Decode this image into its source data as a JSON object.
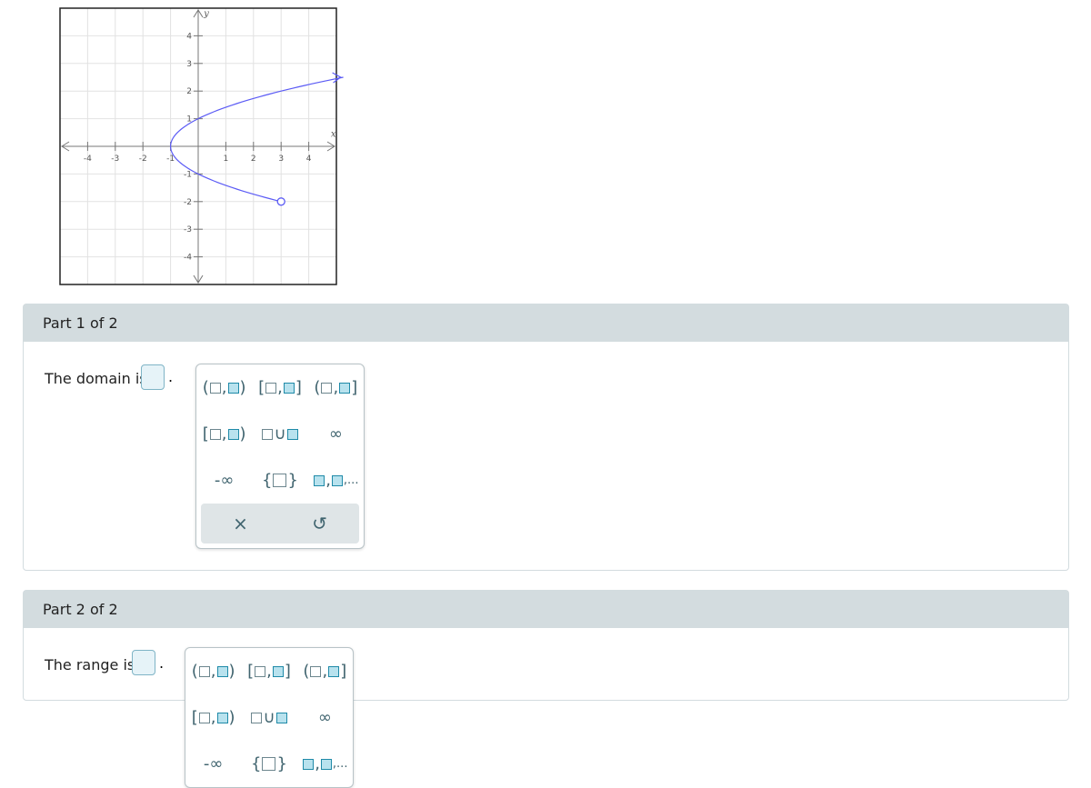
{
  "graph": {
    "x_label": "x",
    "y_label": "y",
    "x_ticks": [
      -4,
      -3,
      -2,
      -1,
      1,
      2,
      3,
      4
    ],
    "y_ticks": [
      -4,
      -3,
      -2,
      -1,
      1,
      2,
      3,
      4
    ],
    "xlim": [
      -5,
      5
    ],
    "ylim": [
      -5,
      5
    ],
    "curve_color": "#5b5bf5",
    "curve": "x = y^2 - 1",
    "y_range": [
      -2,
      2.5
    ],
    "open_point": [
      3,
      -2
    ],
    "arrow_end": [
      5.25,
      2.5
    ]
  },
  "parts": [
    {
      "header": "Part 1 of 2",
      "prompt": "The domain is",
      "period": "."
    },
    {
      "header": "Part 2 of 2",
      "prompt": "The range is",
      "period": "."
    }
  ],
  "keypad": {
    "keys": [
      {
        "name": "open-open-interval",
        "l": "(",
        "r": ")"
      },
      {
        "name": "closed-closed-interval",
        "l": "[",
        "r": "]"
      },
      {
        "name": "open-closed-interval",
        "l": "(",
        "r": "]"
      },
      {
        "name": "closed-open-interval",
        "l": "[",
        "r": ")"
      },
      {
        "name": "union",
        "sym": "∪"
      },
      {
        "name": "infinity",
        "text": "∞"
      },
      {
        "name": "negative-infinity",
        "text": "-∞"
      },
      {
        "name": "set-braces",
        "l": "{",
        "r": "}"
      },
      {
        "name": "list",
        "text": ",..."
      }
    ],
    "clear": "×",
    "undo": "↺"
  }
}
